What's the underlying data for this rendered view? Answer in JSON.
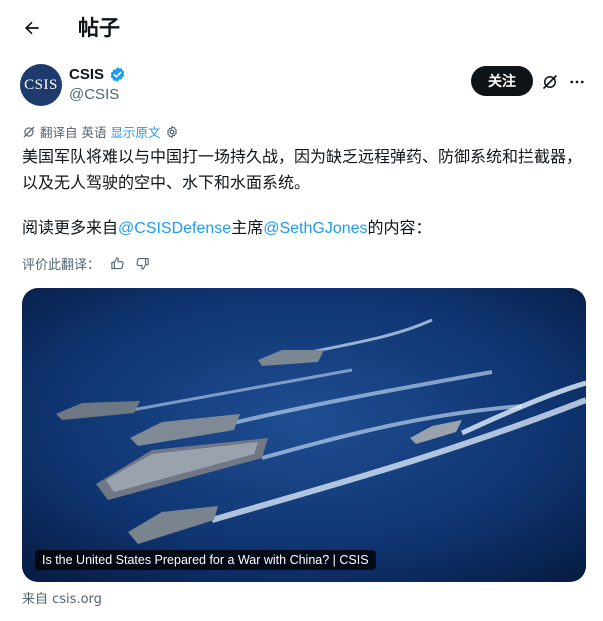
{
  "header": {
    "title": "帖子"
  },
  "author": {
    "avatar_text": "CSIS",
    "display_name": "CSIS",
    "handle": "@CSIS",
    "verified": true
  },
  "actions": {
    "follow_label": "关注"
  },
  "translation": {
    "note": "翻译自 英语",
    "show_original": "显示原文"
  },
  "tweet": {
    "paragraph1": "美国军队将难以与中国打一场持久战，因为缺乏远程弹药、防御系统和拦截器，以及无人驾驶的空中、水下和水面系统。",
    "p2_prefix": "阅读更多来自",
    "mention1": "@CSISDefense",
    "p2_middle": "主席",
    "mention2": "@SethGJones",
    "p2_suffix": "的内容："
  },
  "rating": {
    "label": "评价此翻译："
  },
  "card": {
    "caption": "Is the United States Prepared for a War with China? | CSIS",
    "source": "来自 csis.org"
  },
  "colors": {
    "accent": "#1d9bf0",
    "verified": "#1d9bf0",
    "avatar_bg": "#1f3a6d",
    "text": "#0f1419",
    "muted": "#536471"
  }
}
